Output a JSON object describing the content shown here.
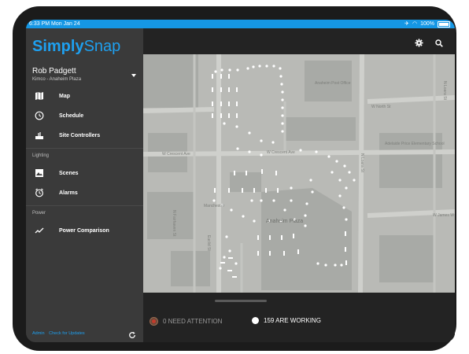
{
  "status_bar": {
    "time": "6:33 PM  Mon Jan 24",
    "battery": "100%"
  },
  "app": {
    "brand_bold": "Simply",
    "brand_light": "Snap"
  },
  "user": {
    "name": "Rob Padgett",
    "site": "Kimco - Anaheim Plaza"
  },
  "nav": {
    "main": [
      {
        "label": "Map",
        "icon": "map-icon"
      },
      {
        "label": "Schedule",
        "icon": "clock-icon"
      },
      {
        "label": "Site Controllers",
        "icon": "controller-icon"
      }
    ],
    "lighting_title": "Lighting",
    "lighting": [
      {
        "label": "Scenes",
        "icon": "image-icon"
      },
      {
        "label": "Alarms",
        "icon": "alarm-icon"
      }
    ],
    "power_title": "Power",
    "power": [
      {
        "label": "Power Comparison",
        "icon": "trend-icon"
      }
    ]
  },
  "footer": {
    "admin": "Admin",
    "updates": "Check for Updates"
  },
  "toolbar": {
    "settings_icon": "gear-icon",
    "search_icon": "search-icon"
  },
  "map": {
    "streets": {
      "n_loara_top": "N Loara St",
      "w_north": "W North St",
      "w_crescent_left": "W Crescent Ave",
      "w_crescent_right": "W Crescent Ave",
      "n_fairhaven": "N Fairhaven St",
      "euclid": "Euclid St",
      "n_loara_mid": "N Loara St",
      "w_james": "W James W",
      "manchester": "Manchester",
      "anaheim_plaza": "Anaheim Plaza"
    },
    "pois": {
      "post_office": "Anaheim Post Office",
      "school": "Adelaide Price Elementary School"
    }
  },
  "stats": {
    "attention": "0 NEED ATTENTION",
    "working": "159 ARE WORKING"
  },
  "colors": {
    "accent": "#1ea0f0",
    "sidebar": "#3a3a3a",
    "map": "#b9bab6",
    "attention": "#c43a2b"
  }
}
